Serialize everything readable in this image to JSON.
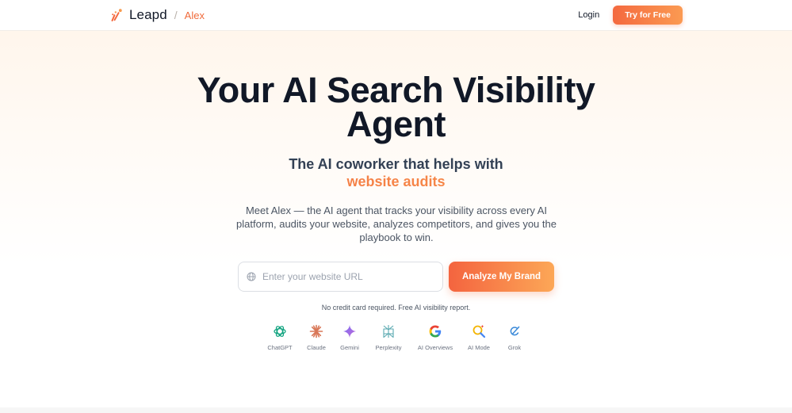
{
  "header": {
    "brand_name": "Leapd",
    "separator": "/",
    "product_name": "Alex",
    "login_label": "Login",
    "cta_label": "Try for Free"
  },
  "hero": {
    "title_lines": [
      "Your AI Search Visibility",
      "Agent"
    ],
    "subtitle": "The AI coworker that helps with",
    "subtitle_highlight": "website audits",
    "description_lines": [
      "Meet Alex — the AI agent that tracks your visibility across every AI",
      "platform, audits your website, analyzes competitors, and gives you the",
      "playbook to win."
    ],
    "url_placeholder": "Enter your website URL",
    "url_value": "",
    "analyze_label": "Analyze My Brand",
    "fine_print": "No credit card required. Free AI visibility report."
  },
  "platforms": [
    {
      "label": "ChatGPT",
      "icon": "chatgpt-icon"
    },
    {
      "label": "Claude",
      "icon": "claude-icon"
    },
    {
      "label": "Gemini",
      "icon": "gemini-icon"
    },
    {
      "label": "Perplexity",
      "icon": "perplexity-icon"
    },
    {
      "label": "AI Overviews",
      "icon": "google-icon"
    },
    {
      "label": "AI Mode",
      "icon": "ai-mode-search-icon"
    },
    {
      "label": "Grok",
      "icon": "grok-icon"
    }
  ],
  "colors": {
    "accent": "#f4693f",
    "accent_end": "#fb9a52",
    "heading": "#111827",
    "body_text": "#4b5563"
  }
}
